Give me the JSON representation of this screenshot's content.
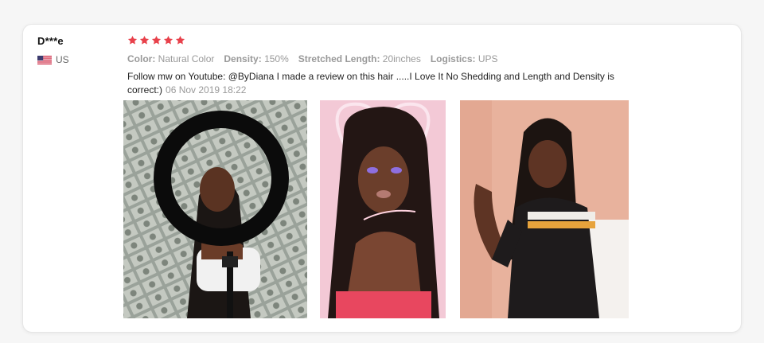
{
  "reviewer": {
    "name": "D***e",
    "country": "US",
    "flag_icon": "us-flag-icon"
  },
  "review": {
    "rating": 5,
    "max_rating": 5,
    "star_color": "#e8414b",
    "specs": [
      {
        "label": "Color:",
        "value": "Natural Color"
      },
      {
        "label": "Density:",
        "value": "150%"
      },
      {
        "label": "Stretched Length:",
        "value": "20inches"
      },
      {
        "label": "Logistics:",
        "value": "UPS"
      }
    ],
    "text": "Follow mw on Youtube: @ByDiana I made a review on this hair .....I Love It No Shedding and Length and Density is correct:)",
    "date": "06 Nov 2019 18:22"
  },
  "photos": [
    {
      "name": "review-photo-1",
      "theme": "ring-light"
    },
    {
      "name": "review-photo-2",
      "theme": "pink-heart"
    },
    {
      "name": "review-photo-3",
      "theme": "peach-wall"
    }
  ]
}
